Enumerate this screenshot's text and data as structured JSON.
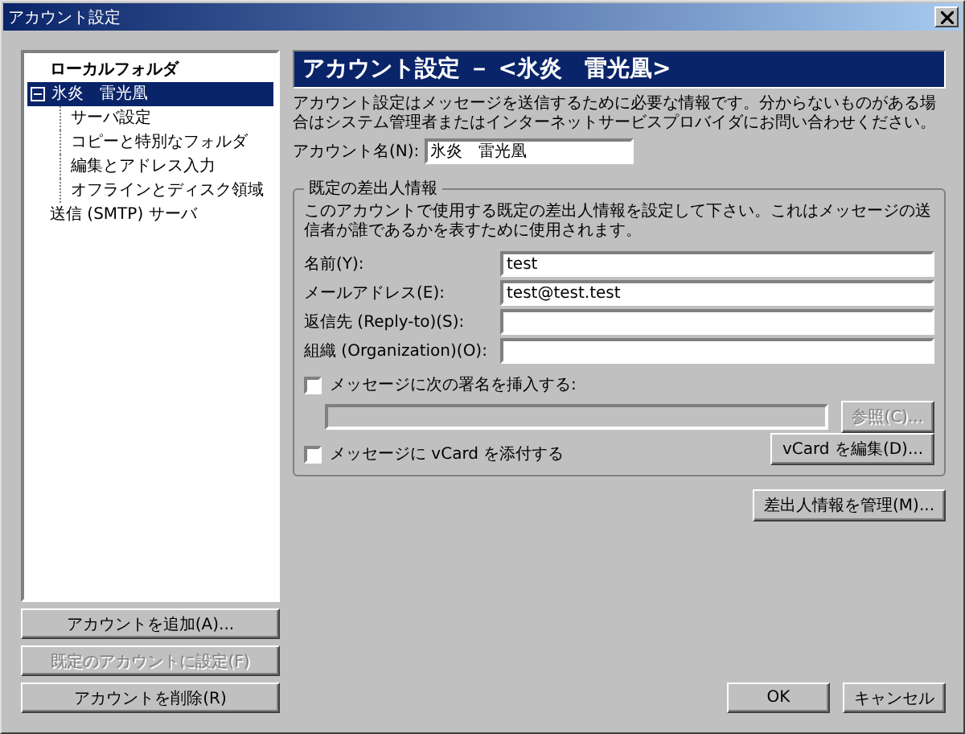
{
  "window": {
    "title": "アカウント設定"
  },
  "tree": [
    {
      "label": "ローカルフォルダ",
      "kind": "root",
      "selected": false
    },
    {
      "label": "氷炎　雷光凰",
      "kind": "account",
      "selected": true,
      "expanded": true,
      "children": [
        {
          "label": "サーバ設定",
          "selected": false
        },
        {
          "label": "コピーと特別なフォルダ",
          "selected": false
        },
        {
          "label": "編集とアドレス入力",
          "selected": false
        },
        {
          "label": "オフラインとディスク領域",
          "selected": false
        }
      ]
    },
    {
      "label": "送信 (SMTP) サーバ",
      "kind": "server",
      "selected": false
    }
  ],
  "account_buttons": [
    {
      "label": "アカウントを追加(A)...",
      "disabled": false
    },
    {
      "label": "既定のアカウントに設定(F)",
      "disabled": true
    },
    {
      "label": "アカウントを削除(R)",
      "disabled": false
    }
  ],
  "header": "アカウント設定 － <氷炎　雷光凰>",
  "intro": "アカウント設定はメッセージを送信するために必要な情報です。分からないものがある場合はシステム管理者またはインターネットサービスプロバイダにお問い合わせください。",
  "account_name": {
    "label": "アカウント名(N):",
    "value": "氷炎　雷光凰"
  },
  "identity": {
    "legend": "既定の差出人情報",
    "description": "このアカウントで使用する既定の差出人情報を設定して下さい。これはメッセージの送信者が誰であるかを表すために使用されます。",
    "fields": [
      {
        "label": "名前(Y):",
        "value": "test"
      },
      {
        "label": "メールアドレス(E):",
        "value": "test@test.test"
      },
      {
        "label": "返信先 (Reply-to)(S):"
      },
      {
        "label": "組織 (Organization)(O):"
      }
    ],
    "signature": {
      "label": "メッセージに次の署名を挿入する:",
      "checked": false,
      "browse": "参照(C)...",
      "disabled": true
    },
    "vcard": {
      "label": "メッセージに vCard を添付する",
      "checked": false,
      "edit": "vCard を編集(D)..."
    }
  },
  "manage_button": "差出人情報を管理(M)...",
  "buttons": [
    "OK",
    "キャンセル"
  ]
}
